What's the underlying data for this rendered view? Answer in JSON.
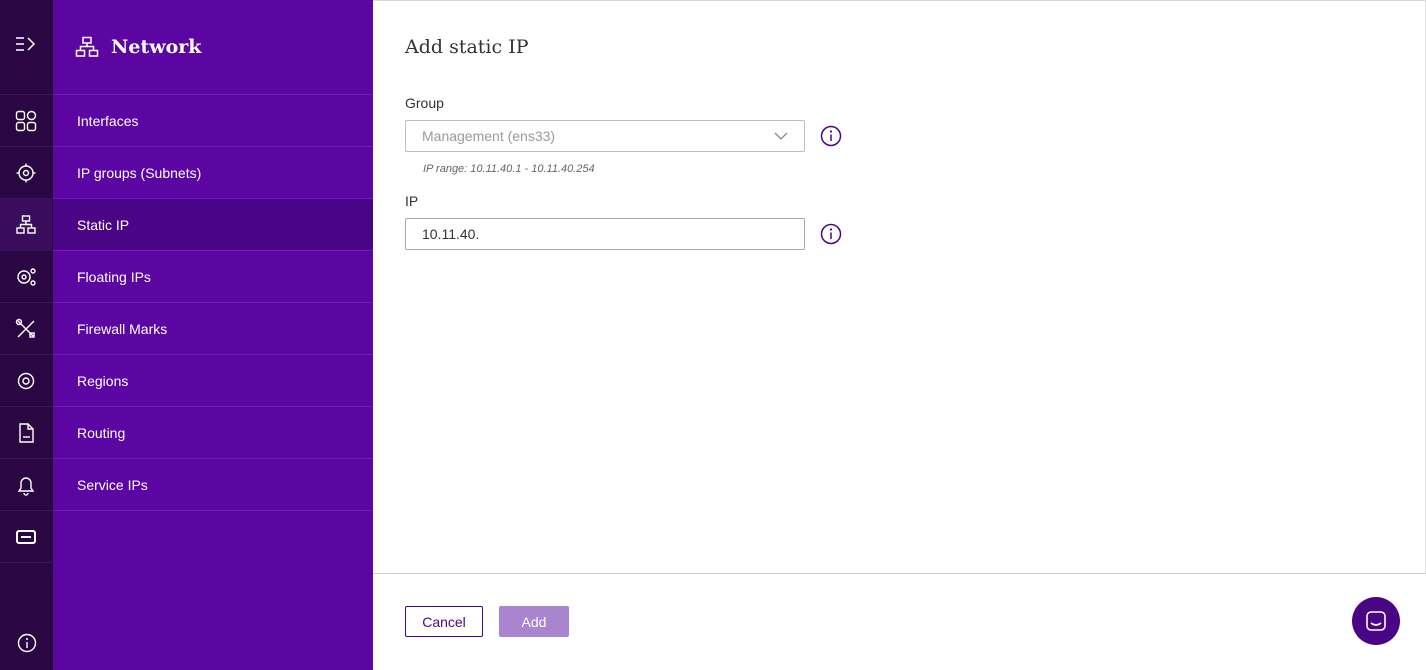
{
  "nav": {
    "title": "Network",
    "items": [
      {
        "label": "Interfaces",
        "icon": "grid-icon"
      },
      {
        "label": "IP groups (Subnets)",
        "icon": "gear-location-icon"
      },
      {
        "label": "Static IP",
        "icon": "network-icon",
        "active": true
      },
      {
        "label": "Floating IPs",
        "icon": "gear-share-icon"
      },
      {
        "label": "Firewall Marks",
        "icon": "tools-icon"
      },
      {
        "label": "Regions",
        "icon": "gear-icon"
      },
      {
        "label": "Routing",
        "icon": "log-file-icon"
      },
      {
        "label": "Service IPs",
        "icon": "bell-icon"
      }
    ]
  },
  "form": {
    "title": "Add static IP",
    "group_label": "Group",
    "group_value": "Management (ens33)",
    "ip_range_hint": "IP range: 10.11.40.1 - 10.11.40.254",
    "ip_label": "IP",
    "ip_value": "10.11.40."
  },
  "actions": {
    "cancel_label": "Cancel",
    "add_label": "Add"
  },
  "colors": {
    "rail": "#2a0742",
    "nav": "#5b06a3",
    "nav_active": "#4a0586",
    "accent": "#4a0586",
    "add_disabled": "#a985d0"
  }
}
